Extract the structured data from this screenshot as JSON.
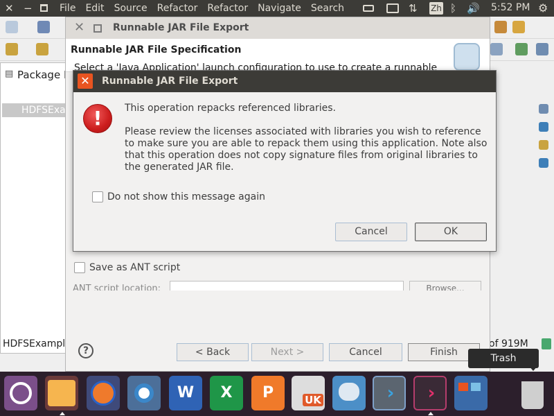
{
  "top_panel": {
    "menu": [
      "File",
      "Edit",
      "Source",
      "Refactor",
      "Refactor",
      "Navigate",
      "Search"
    ],
    "input_method": "Zh",
    "clock": "5:52 PM"
  },
  "eclipse": {
    "package_explorer_title": "Package E",
    "project_item": "HDFSExa",
    "status_left": "HDFSExample",
    "status_right": "of 919M"
  },
  "wizard": {
    "title": "Runnable JAR File Export",
    "heading": "Runnable JAR File Specification",
    "description": "Select a 'Java Application' launch configuration to use to create a runnable",
    "save_ant": "Save as ANT script",
    "ant_location": "ANT script location:",
    "browse": "Browse...",
    "help": "?",
    "back": "< Back",
    "next": "Next >",
    "cancel": "Cancel",
    "finish": "Finish"
  },
  "tooltip": "Trash",
  "modal": {
    "title": "Runnable JAR File Export",
    "headline": "This operation repacks referenced libraries.",
    "body": "Please review the licenses associated with libraries you wish to reference to make sure you are able to repack them using this application. Note also that this operation does not copy signature files from original libraries to the generated JAR file.",
    "checkbox_label": "Do not show this message again",
    "checkbox_checked": false,
    "cancel": "Cancel",
    "ok": "OK"
  },
  "launcher": {
    "items": [
      "Ubuntu Dash",
      "Files",
      "Firefox",
      "Chromium",
      "Writer",
      "Calc",
      "Impress",
      "Ubuntu Software",
      "App",
      "Terminal",
      "Terminal",
      "Workspace Switcher",
      "Trash"
    ],
    "uk_badge": "UK"
  },
  "colors": {
    "panel": "#3c3b37",
    "launcher": "#2c1f2c",
    "accent_orange": "#e95420",
    "error_red": "#cc1d1d"
  }
}
